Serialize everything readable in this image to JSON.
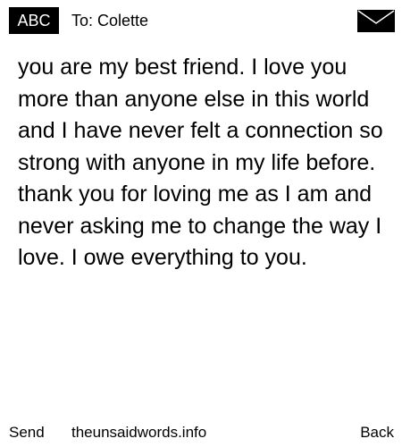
{
  "header": {
    "mode": "ABC",
    "recipient": "To: Colette",
    "icon": "envelope-icon"
  },
  "message": {
    "body": "you are my best friend. I love you more than anyone else in this world and I have never felt a connection so strong with anyone in my life before. thank you for loving me as I am and never asking me to change the way I love. I owe everything to you."
  },
  "footer": {
    "left": "Send",
    "center": "theunsaidwords.info",
    "right": "Back"
  }
}
